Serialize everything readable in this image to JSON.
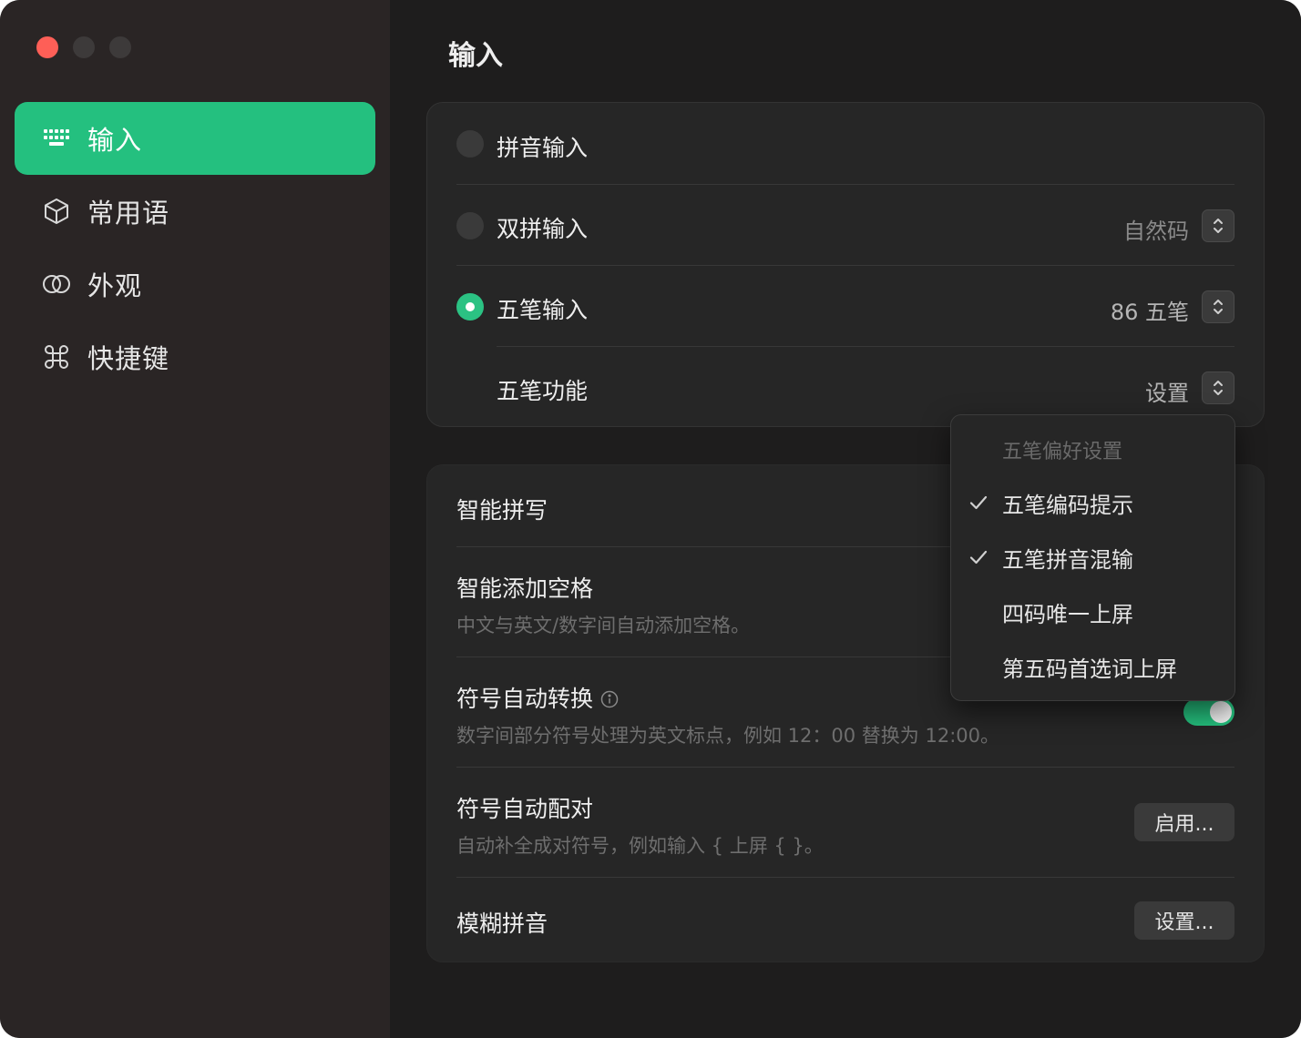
{
  "window": {
    "controls": [
      "close",
      "minimize",
      "zoom"
    ]
  },
  "sidebar": {
    "items": [
      {
        "label": "输入",
        "icon": "keyboard-icon",
        "active": true
      },
      {
        "label": "常用语",
        "icon": "cube-icon",
        "active": false
      },
      {
        "label": "外观",
        "icon": "circles-icon",
        "active": false
      },
      {
        "label": "快捷键",
        "icon": "command-icon",
        "active": false
      }
    ]
  },
  "main": {
    "title": "输入",
    "input_methods": [
      {
        "label": "拼音输入",
        "selected": false,
        "value": ""
      },
      {
        "label": "双拼输入",
        "selected": false,
        "value": "自然码"
      },
      {
        "label": "五笔输入",
        "selected": true,
        "value": "86 五笔"
      }
    ],
    "wubi_features": {
      "label": "五笔功能",
      "value": "设置"
    },
    "settings": [
      {
        "title": "智能拼写",
        "desc": ""
      },
      {
        "title": "智能添加空格",
        "desc": "中文与英文/数字间自动添加空格。"
      },
      {
        "title": "符号自动转换",
        "desc": "数字间部分符号处理为英文标点，例如 12：00 替换为 12:00。",
        "toggle": true
      },
      {
        "title": "符号自动配对",
        "desc": "自动补全成对符号，例如输入 { 上屏 { }。",
        "button": "启用..."
      },
      {
        "title": "模糊拼音",
        "desc": "",
        "button": "设置..."
      }
    ]
  },
  "menu": {
    "header": "五笔偏好设置",
    "items": [
      {
        "label": "五笔编码提示",
        "checked": true
      },
      {
        "label": "五笔拼音混输",
        "checked": true
      },
      {
        "label": "四码唯一上屏",
        "checked": false
      },
      {
        "label": "第五码首选词上屏",
        "checked": false
      }
    ]
  },
  "colors": {
    "accent": "#24c07f",
    "close": "#fe5f57",
    "sidebar_bg": "#2a2525",
    "main_bg": "#1e1d1d",
    "card_bg": "#262626"
  }
}
